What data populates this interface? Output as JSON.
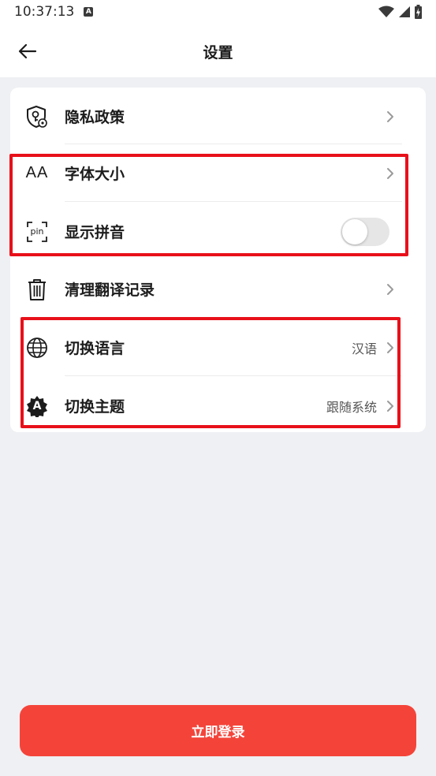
{
  "status_bar": {
    "time": "10:37:13",
    "notif_letter": "A"
  },
  "header": {
    "title": "设置"
  },
  "settings": {
    "privacy": {
      "label": "隐私政策"
    },
    "font_size": {
      "label": "字体大小",
      "icon_text": "AA"
    },
    "pinyin": {
      "label": "显示拼音",
      "icon_text": "pin",
      "enabled": false
    },
    "clear_history": {
      "label": "清理翻译记录"
    },
    "language": {
      "label": "切换语言",
      "value": "汉语"
    },
    "theme": {
      "label": "切换主题",
      "value": "跟随系统",
      "icon_text": "A"
    }
  },
  "login_button": {
    "label": "立即登录"
  },
  "colors": {
    "accent": "#f4443a",
    "highlight": "#e8101a",
    "background": "#eff0f3"
  }
}
